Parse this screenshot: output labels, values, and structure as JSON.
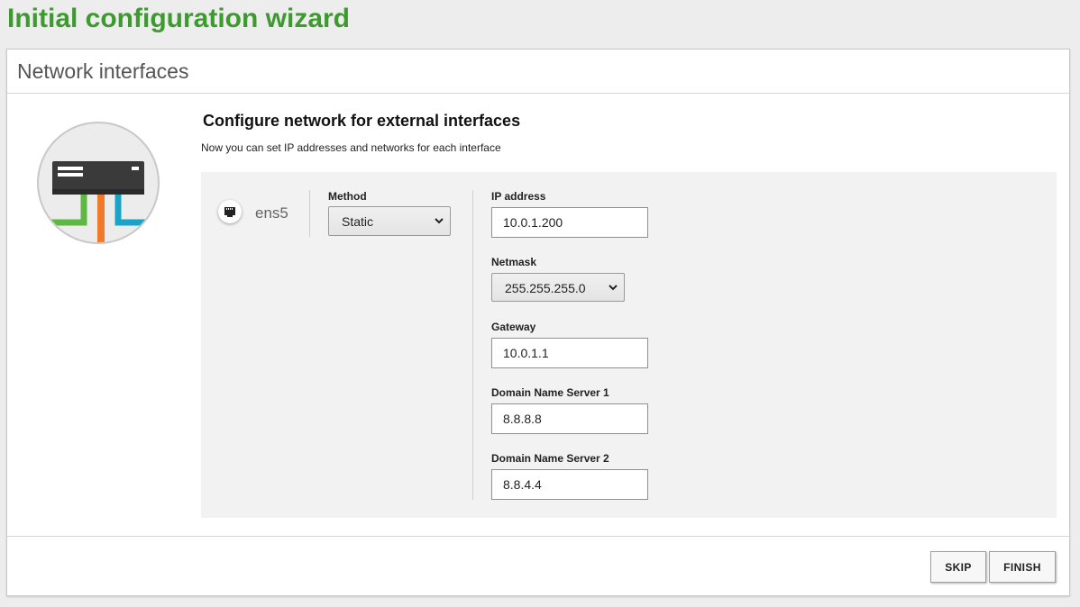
{
  "wizard": {
    "title": "Initial configuration wizard"
  },
  "panel": {
    "title": "Network interfaces"
  },
  "section": {
    "title": "Configure network for external interfaces",
    "description": "Now you can set IP addresses and networks for each interface"
  },
  "interface": {
    "name": "ens5",
    "icon": "ethernet-port-icon",
    "method": {
      "label": "Method",
      "value": "Static"
    },
    "ip_address": {
      "label": "IP address",
      "value": "10.0.1.200"
    },
    "netmask": {
      "label": "Netmask",
      "value": "255.255.255.0"
    },
    "gateway": {
      "label": "Gateway",
      "value": "10.0.1.1"
    },
    "dns1": {
      "label": "Domain Name Server 1",
      "value": "8.8.8.8"
    },
    "dns2": {
      "label": "Domain Name Server 2",
      "value": "8.8.4.4"
    }
  },
  "buttons": {
    "skip": "SKIP",
    "finish": "FINISH"
  },
  "colors": {
    "title_green": "#3c9a2e",
    "cable_green": "#5cb840",
    "cable_orange": "#f07a2a",
    "cable_blue": "#1aa3c9",
    "device_dark": "#3a3a3a"
  }
}
